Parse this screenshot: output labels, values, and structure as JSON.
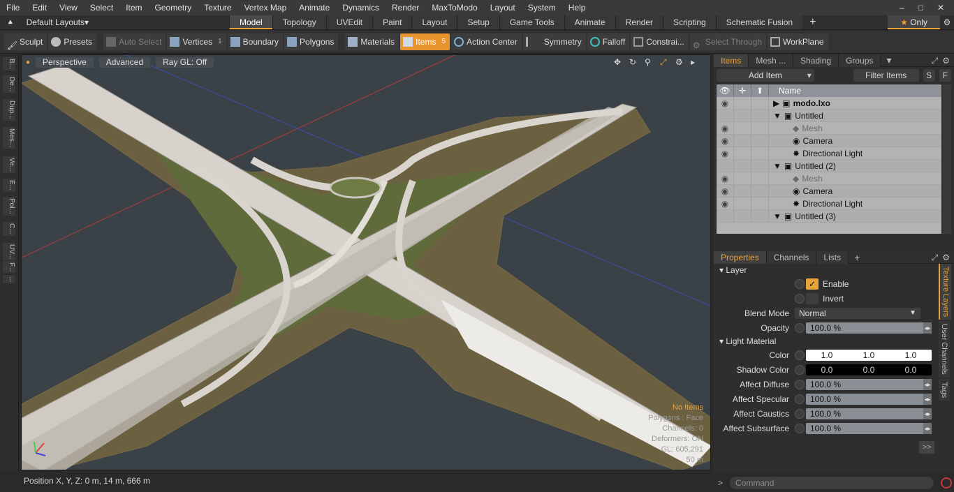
{
  "menu": [
    "File",
    "Edit",
    "View",
    "Select",
    "Item",
    "Geometry",
    "Texture",
    "Vertex Map",
    "Animate",
    "Dynamics",
    "Render",
    "MaxToModo",
    "Layout",
    "System",
    "Help"
  ],
  "window_buttons": [
    "–",
    "□",
    "✕"
  ],
  "layouts_label": "Default Layouts",
  "tabs": [
    "Model",
    "Topology",
    "UVEdit",
    "Paint",
    "Layout",
    "Setup",
    "Game Tools",
    "Animate",
    "Render",
    "Scripting",
    "Schematic Fusion"
  ],
  "only_label": "Only",
  "toolbar": {
    "sculpt": "Sculpt",
    "presets": "Presets",
    "auto_select": "Auto Select",
    "vertices": "Vertices",
    "vertices_count": "1",
    "boundary": "Boundary",
    "polygons": "Polygons",
    "materials": "Materials",
    "items": "Items",
    "items_count": "5",
    "action_center": "Action Center",
    "symmetry": "Symmetry",
    "falloff": "Falloff",
    "constrain": "Constrai...",
    "select_through": "Select Through",
    "workplane": "WorkPlane"
  },
  "left_tabs": [
    "B...",
    "De...",
    "Dup...",
    "Mes...",
    "Ve...",
    "E...",
    "Pol...",
    "C...",
    "UV...",
    "F...",
    "..."
  ],
  "viewport": {
    "view": "Perspective",
    "shading": "Advanced",
    "raygl": "Ray GL: Off",
    "stats": {
      "items": "No Items",
      "polygons": "Polygons : Face",
      "channels": "Channels: 0",
      "deformers": "Deformers: ON",
      "gl": "GL: 605,291",
      "scale": "50 m"
    }
  },
  "status": "Position X, Y, Z:   0 m, 14 m, 666 m",
  "items_panel": {
    "tabs": [
      "Items",
      "Mesh ...",
      "Shading",
      "Groups"
    ],
    "add_item": "Add Item",
    "filter": "Filter Items",
    "s_btn": "S",
    "f_btn": "F",
    "col_name": "Name",
    "rows": [
      {
        "name": "modo.lxo",
        "indent": 0,
        "arrow": "▶",
        "icon": "🎬",
        "eye": "●",
        "style": "bold"
      },
      {
        "name": "Untitled",
        "indent": 0,
        "arrow": "▼",
        "icon": "🎬",
        "eye": "",
        "style": ""
      },
      {
        "name": "Mesh",
        "indent": 1,
        "arrow": "",
        "icon": "◆",
        "eye": "●",
        "style": "dim"
      },
      {
        "name": "Camera",
        "indent": 1,
        "arrow": "",
        "icon": "◉",
        "eye": "●",
        "style": ""
      },
      {
        "name": "Directional Light",
        "indent": 1,
        "arrow": "",
        "icon": "✸",
        "eye": "●",
        "style": ""
      },
      {
        "name": "Untitled (2)",
        "indent": 0,
        "arrow": "▼",
        "icon": "🎬",
        "eye": "",
        "style": ""
      },
      {
        "name": "Mesh",
        "indent": 1,
        "arrow": "",
        "icon": "◆",
        "eye": "●",
        "style": "dim"
      },
      {
        "name": "Camera",
        "indent": 1,
        "arrow": "",
        "icon": "◉",
        "eye": "●",
        "style": ""
      },
      {
        "name": "Directional Light",
        "indent": 1,
        "arrow": "",
        "icon": "✸",
        "eye": "●",
        "style": ""
      },
      {
        "name": "Untitled (3)",
        "indent": 0,
        "arrow": "▼",
        "icon": "🎬",
        "eye": "",
        "style": ""
      }
    ]
  },
  "props_panel": {
    "tabs": [
      "Properties",
      "Channels",
      "Lists"
    ],
    "layer_section": "Layer",
    "enable": "Enable",
    "invert": "Invert",
    "blend_mode_label": "Blend Mode",
    "blend_mode": "Normal",
    "opacity_label": "Opacity",
    "opacity": "100.0 %",
    "light_section": "Light Material",
    "color_label": "Color",
    "color": [
      "1.0",
      "1.0",
      "1.0"
    ],
    "shadow_label": "Shadow Color",
    "shadow": [
      "0.0",
      "0.0",
      "0.0"
    ],
    "affect_diffuse_label": "Affect Diffuse",
    "affect_diffuse": "100.0 %",
    "affect_specular_label": "Affect Specular",
    "affect_specular": "100.0 %",
    "affect_caustics_label": "Affect Caustics",
    "affect_caustics": "100.0 %",
    "affect_subsurface_label": "Affect Subsurface",
    "affect_subsurface": "100.0 %",
    "side_tabs": [
      "Texture Layers",
      "User Channels",
      "Tags"
    ],
    "expand": ">>"
  },
  "command_placeholder": "Command",
  "colors": {
    "accent": "#e8a33a",
    "viewport_bg": "#3a4147"
  }
}
